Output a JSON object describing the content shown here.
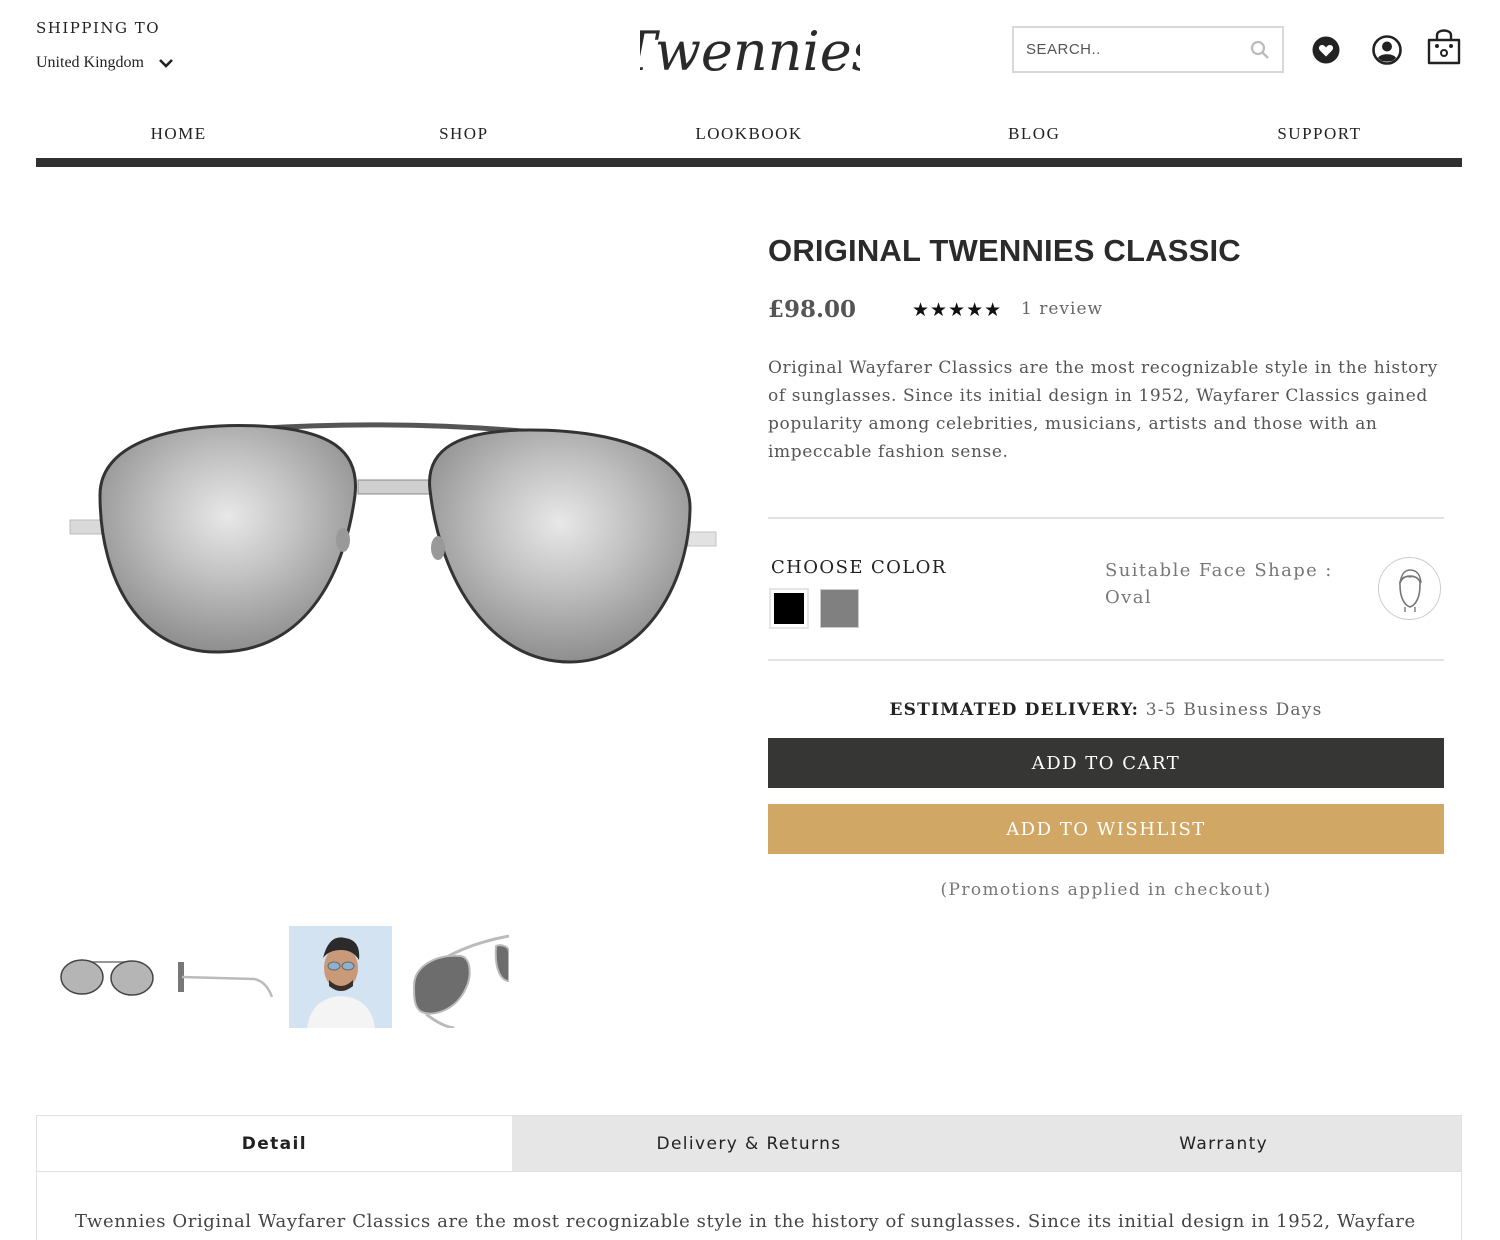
{
  "header": {
    "shipping_label": "SHIPPING TO",
    "shipping_country": "United Kingdom",
    "logo_text": "Twennies",
    "search_placeholder": "SEARCH..",
    "icons": [
      "search-icon",
      "heart-icon",
      "account-icon",
      "shopping-bag-icon"
    ]
  },
  "nav": [
    "HOME",
    "SHOP",
    "LOOKBOOK",
    "BLOG",
    "SUPPORT"
  ],
  "product": {
    "title": "ORIGINAL TWENNIES CLASSIC",
    "price": "£98.00",
    "rating_stars": "★★★★★",
    "rating": 5,
    "reviews": "1 review",
    "description": "Original Wayfarer Classics are the most recognizable style in the history of sunglasses. Since its initial design in 1952, Wayfarer Classics gained popularity among celebrities, musicians, artists and those with an impeccable fashion sense.",
    "choose_color_label": "CHOOSE COLOR",
    "colors": [
      {
        "name": "black",
        "hex": "#000000",
        "selected": true
      },
      {
        "name": "gray",
        "hex": "#808080",
        "selected": false
      }
    ],
    "face_shape_label": "Suitable Face Shape :",
    "face_shape_value": "Oval",
    "delivery_label": "ESTIMATED DELIVERY:",
    "delivery_value": "3-5 Business Days",
    "add_to_cart": "ADD TO CART",
    "add_to_wishlist": "ADD TO WISHLIST",
    "promo_note": "(Promotions applied in checkout)"
  },
  "tabs": {
    "items": [
      "Detail",
      "Delivery & Returns",
      "Warranty"
    ],
    "active": "Detail",
    "detail_text": "Twennies Original Wayfarer Classics are the most recognizable style in the history of sunglasses. Since its initial design in 1952, Wayfarer"
  },
  "colors": {
    "dark": "#363735",
    "gold": "#d1a766",
    "tab_bg": "#e6e6e6"
  }
}
